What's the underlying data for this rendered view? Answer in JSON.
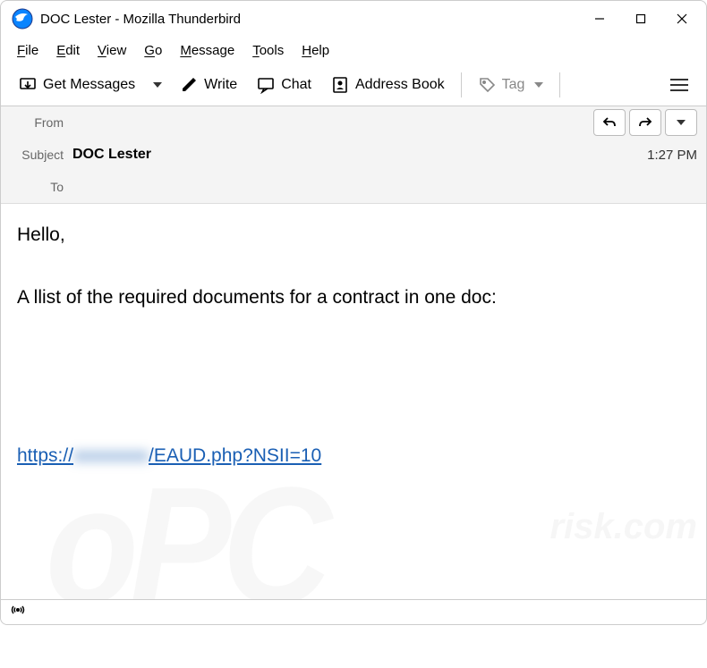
{
  "window": {
    "title": "DOC Lester - Mozilla Thunderbird"
  },
  "menubar": {
    "file": "File",
    "edit": "Edit",
    "view": "View",
    "go": "Go",
    "message": "Message",
    "tools": "Tools",
    "help": "Help"
  },
  "toolbar": {
    "get_messages": "Get Messages",
    "write": "Write",
    "chat": "Chat",
    "address_book": "Address Book",
    "tag": "Tag"
  },
  "headers": {
    "from_label": "From",
    "from_value": "",
    "subject_label": "Subject",
    "subject_value": "DOC Lester",
    "time": "1:27 PM",
    "to_label": "To",
    "to_value": ""
  },
  "body": {
    "greeting": "Hello,",
    "line1": "A llist of the required documents for a contract in one doc:",
    "link_prefix": "https://",
    "link_blurred": "xxxxxxxx",
    "link_suffix": "/EAUD.php?NSII=10"
  },
  "watermark": {
    "main": "oPC",
    "sub": "risk.com"
  }
}
